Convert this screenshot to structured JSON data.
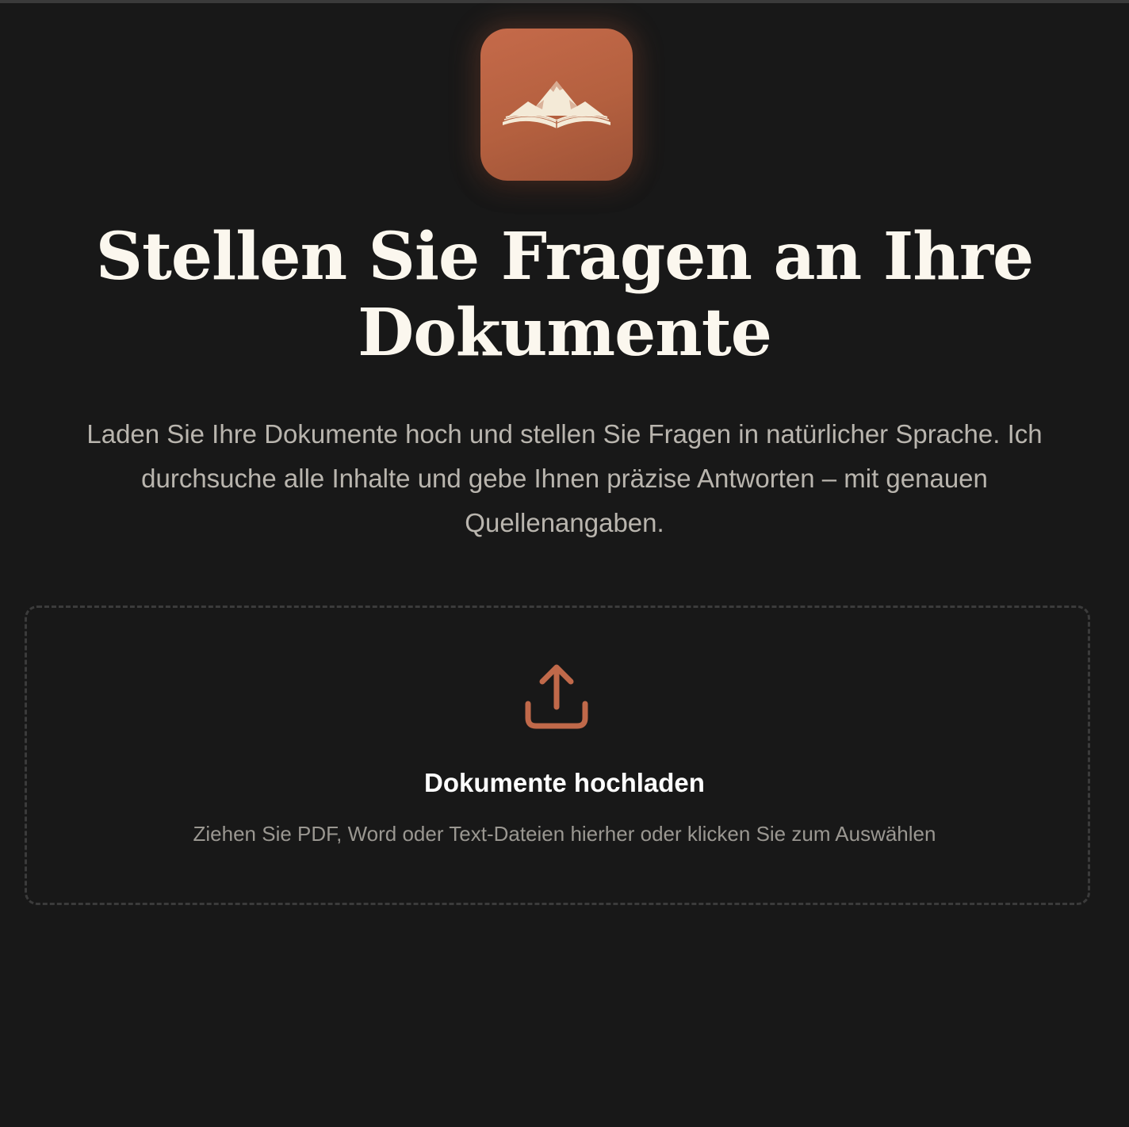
{
  "colors": {
    "background": "#181818",
    "accent": "#c0694a",
    "logo_mark": "#f4ead7",
    "title": "#fbf7ee",
    "subtitle": "#b9b5ae",
    "dropzone_border": "#3b3b3b",
    "hint": "#9a9791"
  },
  "logo": {
    "icon": "book-mountain-icon"
  },
  "hero": {
    "title_line1": "Stellen Sie Fragen an Ihre",
    "title_line2": "Dokumente",
    "subtitle_line1": "Laden Sie Ihre Dokumente hoch und stellen Sie Fragen in natürlicher Sprache. Ich",
    "subtitle_line2": "durchsuche alle Inhalte und gebe Ihnen präzise Antworten – mit genauen",
    "subtitle_line3": "Quellenangaben."
  },
  "upload": {
    "icon": "upload-icon",
    "title": "Dokumente hochladen",
    "hint": "Ziehen Sie PDF, Word oder Text-Dateien hierher oder klicken Sie zum Auswählen"
  }
}
